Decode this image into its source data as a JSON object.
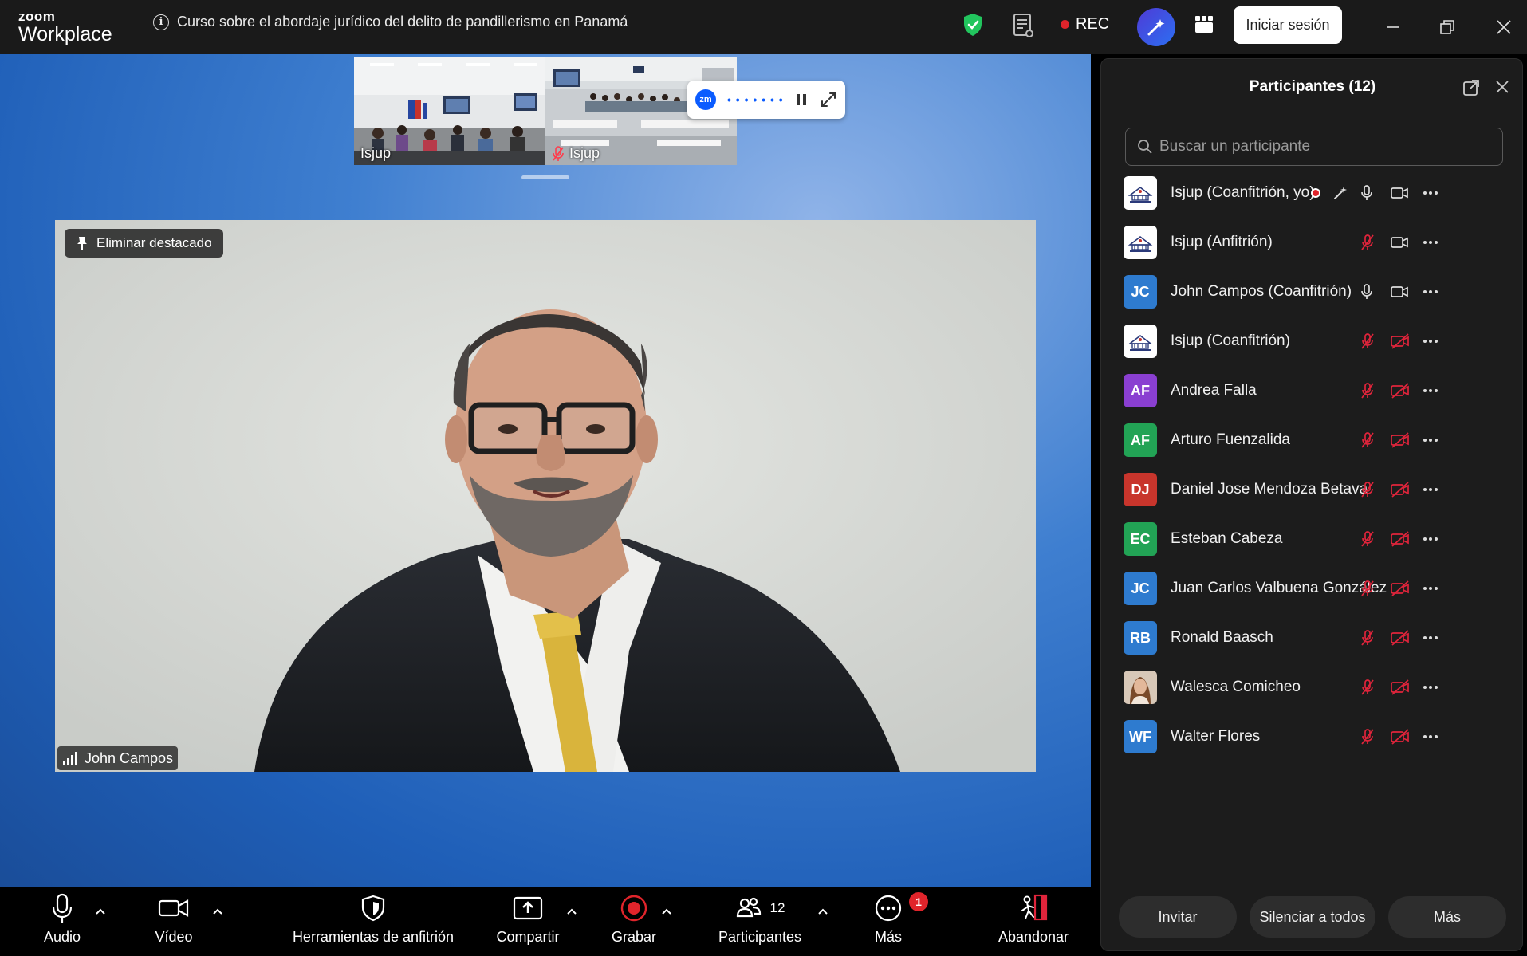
{
  "app": {
    "brand_small": "zoom",
    "brand_large": "Workplace",
    "meeting_title": "Curso sobre el abordaje jurídico del delito de pandillerismo  en Panamá",
    "rec_label": "REC",
    "signin_label": "Iniciar sesión"
  },
  "thumbnails": [
    {
      "label": "Isjup"
    },
    {
      "label": "Isjup"
    }
  ],
  "main_video": {
    "unpin_label": "Eliminar destacado",
    "speaker_name": "John Campos"
  },
  "participants_panel": {
    "title": "Participantes (12)",
    "search_placeholder": "Buscar un participante",
    "participants": [
      {
        "name": "Isjup (Coanfitrión, yo)",
        "initials": "",
        "avatar": "logo",
        "recording": true,
        "mic": "on",
        "video": "on"
      },
      {
        "name": "Isjup (Anfitrión)",
        "initials": "",
        "avatar": "logo",
        "mic": "muted",
        "video": "on"
      },
      {
        "name": "John Campos (Coanfitrión)",
        "initials": "JC",
        "avatar_color": "#2e7bcf",
        "mic": "on",
        "video": "on"
      },
      {
        "name": "Isjup (Coanfitrión)",
        "initials": "",
        "avatar": "logo",
        "mic": "muted",
        "video": "off"
      },
      {
        "name": "Andrea Falla",
        "initials": "AF",
        "avatar_color": "#8a3fd1",
        "mic": "muted",
        "video": "off"
      },
      {
        "name": "Arturo Fuenzalida",
        "initials": "AF",
        "avatar_color": "#22a355",
        "mic": "muted",
        "video": "off"
      },
      {
        "name": "Daniel Jose Mendoza Betava",
        "initials": "DJ",
        "avatar_color": "#c8352c",
        "mic": "muted",
        "video": "off"
      },
      {
        "name": "Esteban Cabeza",
        "initials": "EC",
        "avatar_color": "#22a355",
        "mic": "muted",
        "video": "off"
      },
      {
        "name": "Juan Carlos Valbuena González",
        "initials": "JC",
        "avatar_color": "#2e7bcf",
        "mic": "muted",
        "video": "off"
      },
      {
        "name": "Ronald Baasch",
        "initials": "RB",
        "avatar_color": "#2e7bcf",
        "mic": "muted",
        "video": "off"
      },
      {
        "name": "Walesca Comicheo",
        "initials": "",
        "avatar": "photo",
        "mic": "muted",
        "video": "off"
      },
      {
        "name": "Walter Flores",
        "initials": "WF",
        "avatar_color": "#2e7bcf",
        "mic": "muted",
        "video": "off"
      }
    ],
    "invite_label": "Invitar",
    "mute_all_label": "Silenciar a todos",
    "more_label": "Más"
  },
  "toolbar": {
    "audio_label": "Audio",
    "video_label": "Vídeo",
    "host_tools_label": "Herramientas de anfitrión",
    "share_label": "Compartir",
    "record_label": "Grabar",
    "participants_label": "Participantes",
    "participants_count": "12",
    "more_label": "Más",
    "more_badge": "1",
    "leave_label": "Abandonar"
  },
  "colors": {
    "muted_red": "#e0243b",
    "rec_red": "#e0242b",
    "shield_green": "#22c55e",
    "zoom_blue": "#0b5cff"
  }
}
